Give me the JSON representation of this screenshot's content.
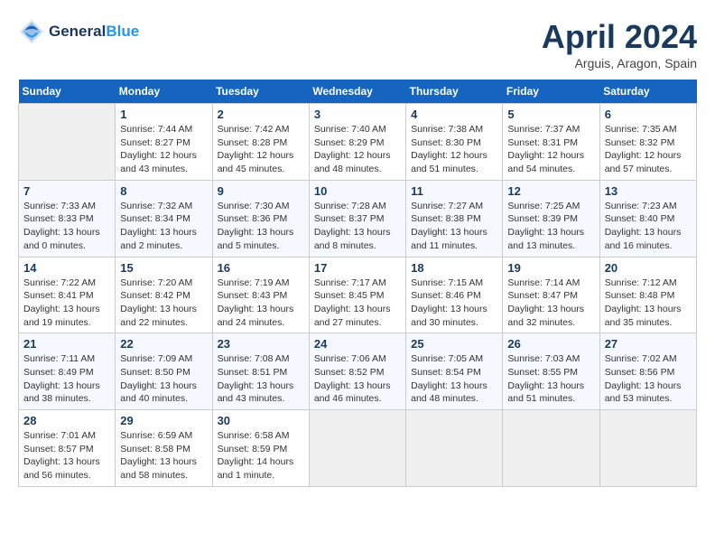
{
  "header": {
    "logo_line1": "General",
    "logo_line2": "Blue",
    "month_title": "April 2024",
    "location": "Arguis, Aragon, Spain"
  },
  "weekdays": [
    "Sunday",
    "Monday",
    "Tuesday",
    "Wednesday",
    "Thursday",
    "Friday",
    "Saturday"
  ],
  "weeks": [
    [
      {
        "day": "",
        "sunrise": "",
        "sunset": "",
        "daylight": ""
      },
      {
        "day": "1",
        "sunrise": "Sunrise: 7:44 AM",
        "sunset": "Sunset: 8:27 PM",
        "daylight": "Daylight: 12 hours and 43 minutes."
      },
      {
        "day": "2",
        "sunrise": "Sunrise: 7:42 AM",
        "sunset": "Sunset: 8:28 PM",
        "daylight": "Daylight: 12 hours and 45 minutes."
      },
      {
        "day": "3",
        "sunrise": "Sunrise: 7:40 AM",
        "sunset": "Sunset: 8:29 PM",
        "daylight": "Daylight: 12 hours and 48 minutes."
      },
      {
        "day": "4",
        "sunrise": "Sunrise: 7:38 AM",
        "sunset": "Sunset: 8:30 PM",
        "daylight": "Daylight: 12 hours and 51 minutes."
      },
      {
        "day": "5",
        "sunrise": "Sunrise: 7:37 AM",
        "sunset": "Sunset: 8:31 PM",
        "daylight": "Daylight: 12 hours and 54 minutes."
      },
      {
        "day": "6",
        "sunrise": "Sunrise: 7:35 AM",
        "sunset": "Sunset: 8:32 PM",
        "daylight": "Daylight: 12 hours and 57 minutes."
      }
    ],
    [
      {
        "day": "7",
        "sunrise": "Sunrise: 7:33 AM",
        "sunset": "Sunset: 8:33 PM",
        "daylight": "Daylight: 13 hours and 0 minutes."
      },
      {
        "day": "8",
        "sunrise": "Sunrise: 7:32 AM",
        "sunset": "Sunset: 8:34 PM",
        "daylight": "Daylight: 13 hours and 2 minutes."
      },
      {
        "day": "9",
        "sunrise": "Sunrise: 7:30 AM",
        "sunset": "Sunset: 8:36 PM",
        "daylight": "Daylight: 13 hours and 5 minutes."
      },
      {
        "day": "10",
        "sunrise": "Sunrise: 7:28 AM",
        "sunset": "Sunset: 8:37 PM",
        "daylight": "Daylight: 13 hours and 8 minutes."
      },
      {
        "day": "11",
        "sunrise": "Sunrise: 7:27 AM",
        "sunset": "Sunset: 8:38 PM",
        "daylight": "Daylight: 13 hours and 11 minutes."
      },
      {
        "day": "12",
        "sunrise": "Sunrise: 7:25 AM",
        "sunset": "Sunset: 8:39 PM",
        "daylight": "Daylight: 13 hours and 13 minutes."
      },
      {
        "day": "13",
        "sunrise": "Sunrise: 7:23 AM",
        "sunset": "Sunset: 8:40 PM",
        "daylight": "Daylight: 13 hours and 16 minutes."
      }
    ],
    [
      {
        "day": "14",
        "sunrise": "Sunrise: 7:22 AM",
        "sunset": "Sunset: 8:41 PM",
        "daylight": "Daylight: 13 hours and 19 minutes."
      },
      {
        "day": "15",
        "sunrise": "Sunrise: 7:20 AM",
        "sunset": "Sunset: 8:42 PM",
        "daylight": "Daylight: 13 hours and 22 minutes."
      },
      {
        "day": "16",
        "sunrise": "Sunrise: 7:19 AM",
        "sunset": "Sunset: 8:43 PM",
        "daylight": "Daylight: 13 hours and 24 minutes."
      },
      {
        "day": "17",
        "sunrise": "Sunrise: 7:17 AM",
        "sunset": "Sunset: 8:45 PM",
        "daylight": "Daylight: 13 hours and 27 minutes."
      },
      {
        "day": "18",
        "sunrise": "Sunrise: 7:15 AM",
        "sunset": "Sunset: 8:46 PM",
        "daylight": "Daylight: 13 hours and 30 minutes."
      },
      {
        "day": "19",
        "sunrise": "Sunrise: 7:14 AM",
        "sunset": "Sunset: 8:47 PM",
        "daylight": "Daylight: 13 hours and 32 minutes."
      },
      {
        "day": "20",
        "sunrise": "Sunrise: 7:12 AM",
        "sunset": "Sunset: 8:48 PM",
        "daylight": "Daylight: 13 hours and 35 minutes."
      }
    ],
    [
      {
        "day": "21",
        "sunrise": "Sunrise: 7:11 AM",
        "sunset": "Sunset: 8:49 PM",
        "daylight": "Daylight: 13 hours and 38 minutes."
      },
      {
        "day": "22",
        "sunrise": "Sunrise: 7:09 AM",
        "sunset": "Sunset: 8:50 PM",
        "daylight": "Daylight: 13 hours and 40 minutes."
      },
      {
        "day": "23",
        "sunrise": "Sunrise: 7:08 AM",
        "sunset": "Sunset: 8:51 PM",
        "daylight": "Daylight: 13 hours and 43 minutes."
      },
      {
        "day": "24",
        "sunrise": "Sunrise: 7:06 AM",
        "sunset": "Sunset: 8:52 PM",
        "daylight": "Daylight: 13 hours and 46 minutes."
      },
      {
        "day": "25",
        "sunrise": "Sunrise: 7:05 AM",
        "sunset": "Sunset: 8:54 PM",
        "daylight": "Daylight: 13 hours and 48 minutes."
      },
      {
        "day": "26",
        "sunrise": "Sunrise: 7:03 AM",
        "sunset": "Sunset: 8:55 PM",
        "daylight": "Daylight: 13 hours and 51 minutes."
      },
      {
        "day": "27",
        "sunrise": "Sunrise: 7:02 AM",
        "sunset": "Sunset: 8:56 PM",
        "daylight": "Daylight: 13 hours and 53 minutes."
      }
    ],
    [
      {
        "day": "28",
        "sunrise": "Sunrise: 7:01 AM",
        "sunset": "Sunset: 8:57 PM",
        "daylight": "Daylight: 13 hours and 56 minutes."
      },
      {
        "day": "29",
        "sunrise": "Sunrise: 6:59 AM",
        "sunset": "Sunset: 8:58 PM",
        "daylight": "Daylight: 13 hours and 58 minutes."
      },
      {
        "day": "30",
        "sunrise": "Sunrise: 6:58 AM",
        "sunset": "Sunset: 8:59 PM",
        "daylight": "Daylight: 14 hours and 1 minute."
      },
      {
        "day": "",
        "sunrise": "",
        "sunset": "",
        "daylight": ""
      },
      {
        "day": "",
        "sunrise": "",
        "sunset": "",
        "daylight": ""
      },
      {
        "day": "",
        "sunrise": "",
        "sunset": "",
        "daylight": ""
      },
      {
        "day": "",
        "sunrise": "",
        "sunset": "",
        "daylight": ""
      }
    ]
  ]
}
